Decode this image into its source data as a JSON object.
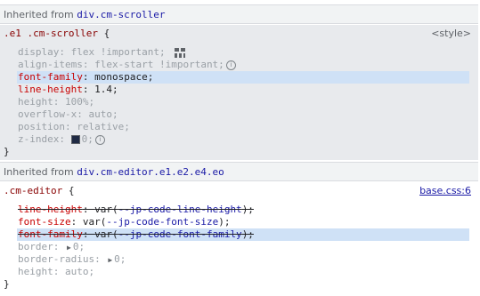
{
  "inherited1": {
    "label": "Inherited from ",
    "node": "div.cm-scroller"
  },
  "rule1": {
    "selector": ".e1 .cm-scroller",
    "open": "{",
    "close": "}",
    "source": "<style>",
    "props": [
      {
        "name": "display",
        "value": "flex !important;"
      },
      {
        "name": "align-items",
        "value": "flex-start !important;"
      },
      {
        "name": "font-family",
        "value": "monospace;"
      },
      {
        "name": "line-height",
        "value": "1.4;"
      },
      {
        "name": "height",
        "value": "100%;"
      },
      {
        "name": "overflow-x",
        "value": "auto;"
      },
      {
        "name": "position",
        "value": "relative;"
      },
      {
        "name": "z-index",
        "value": "0;"
      }
    ]
  },
  "inherited2": {
    "label": "Inherited from ",
    "node": "div.cm-editor.e1.e2.e4.eo"
  },
  "rule2": {
    "selector": ".cm-editor",
    "open": "{",
    "close": "}",
    "source": "base.css:6",
    "props": [
      {
        "name": "line-height",
        "value_pre": "var(",
        "var": "--jp-code-line-height",
        "value_post": ");"
      },
      {
        "name": "font-size",
        "value_pre": "var(",
        "var": "--jp-code-font-size",
        "value_post": ");"
      },
      {
        "name": "font-family",
        "value_pre": "var(",
        "var": "--jp-code-font-family",
        "value_post": ");"
      },
      {
        "name": "border",
        "value": "0;"
      },
      {
        "name": "border-radius",
        "value": "0;"
      },
      {
        "name": "height",
        "value": "auto;"
      }
    ]
  },
  "sep": ": "
}
